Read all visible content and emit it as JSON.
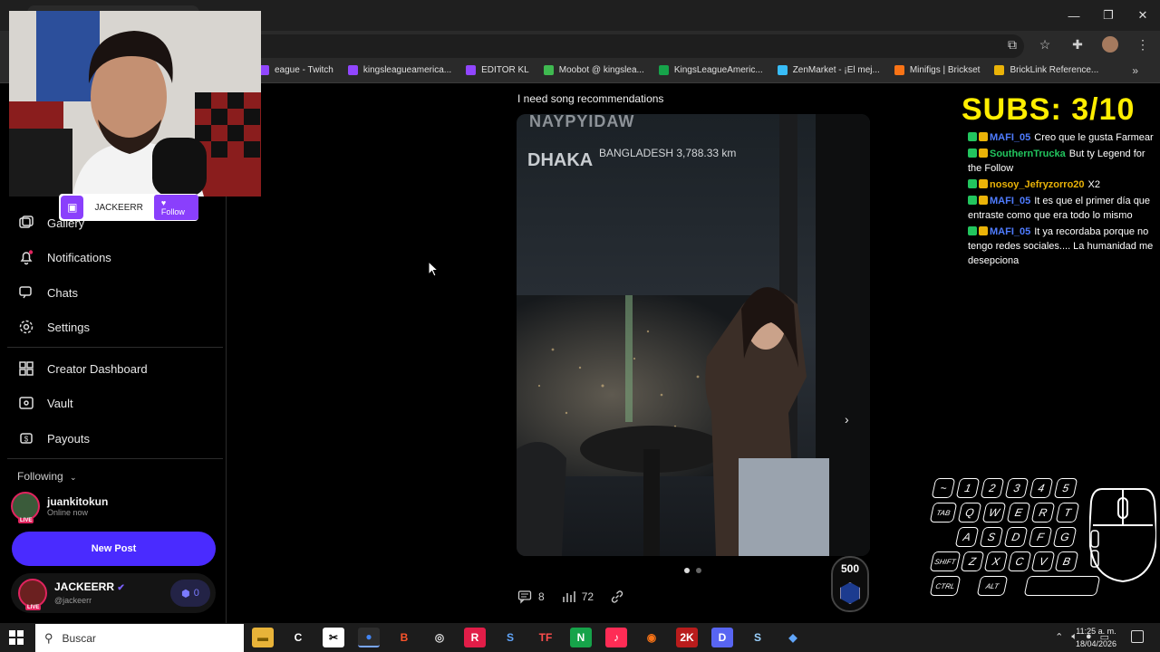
{
  "browser": {
    "bookmarks": [
      {
        "label": "eague - Twitch",
        "color": "#9146ff"
      },
      {
        "label": "kingsleagueamerica...",
        "color": "#9146ff"
      },
      {
        "label": "EDITOR KL",
        "color": "#9146ff"
      },
      {
        "label": "Moobot @ kingslea...",
        "color": "#3fb950"
      },
      {
        "label": "KingsLeagueAmeric...",
        "color": "#16a34a"
      },
      {
        "label": "ZenMarket - ¡El mej...",
        "color": "#38bdf8"
      },
      {
        "label": "Minifigs | Brickset",
        "color": "#f97316"
      },
      {
        "label": "BrickLink Reference...",
        "color": "#eab308"
      }
    ],
    "more_bookmarks_glyph": "»"
  },
  "sidebar": {
    "items": [
      {
        "label": "Gallery",
        "icon": "gallery-icon"
      },
      {
        "label": "Notifications",
        "icon": "bell-icon"
      },
      {
        "label": "Chats",
        "icon": "chat-icon"
      },
      {
        "label": "Settings",
        "icon": "gear-icon"
      },
      {
        "label": "Creator Dashboard",
        "icon": "dashboard-icon"
      },
      {
        "label": "Vault",
        "icon": "vault-icon"
      },
      {
        "label": "Payouts",
        "icon": "payouts-icon"
      }
    ],
    "following_label": "Following",
    "following_user": {
      "name": "juankitokun",
      "status": "Online now",
      "live": "LIVE"
    },
    "new_post_label": "New Post",
    "me": {
      "name": "JACKEERR",
      "handle": "@jackeerr",
      "live": "LIVE",
      "points": "0"
    }
  },
  "post": {
    "text": "I need song recommendations",
    "overlay_top": "NAYPYIDAW",
    "overlay_city": "DHAKA",
    "overlay_country": "BANGLADESH  3,788.33 km",
    "comments": "8",
    "views": "72",
    "carousel_next": "›"
  },
  "stream": {
    "follow_name": "JACKEERR",
    "follow_button": "Follow",
    "subs": "SUBS:  3/10",
    "points_value": "500",
    "chat": [
      {
        "user": "MAFI_05",
        "user_color": "#4f7cff",
        "badges": [
          "k",
          "y"
        ],
        "text": "Creo que le gusta Farmear"
      },
      {
        "user": "SouthernTrucka",
        "user_color": "#22c55e",
        "badges": [
          "k",
          "y"
        ],
        "text": "But ty Legend for the Follow"
      },
      {
        "user": "nosoy_Jefryzorro20",
        "user_color": "#eab308",
        "badges": [
          "k",
          "y"
        ],
        "text": "X2"
      },
      {
        "user": "MAFI_05",
        "user_color": "#4f7cff",
        "badges": [
          "k",
          "y"
        ],
        "text": "It es que el primer día que entraste como que era todo lo mismo"
      },
      {
        "user": "MAFI_05",
        "user_color": "#4f7cff",
        "badges": [
          "k",
          "y"
        ],
        "text": "It ya recordaba porque no tengo redes sociales.... La humanidad me desepciona"
      }
    ],
    "keyboard": {
      "row1": [
        "~",
        "1",
        "2",
        "3",
        "4",
        "5"
      ],
      "row2": [
        "TAB",
        "Q",
        "W",
        "E",
        "R",
        "T"
      ],
      "row3": [
        "A",
        "S",
        "D",
        "F",
        "G"
      ],
      "row4": [
        "SHIFT",
        "Z",
        "X",
        "C",
        "V",
        "B"
      ],
      "row5": [
        "CTRL",
        "ALT",
        ""
      ]
    }
  },
  "taskbar": {
    "search_placeholder": "Buscar",
    "time": "11:25 a. m.",
    "date": "18/04/2026",
    "apps": [
      {
        "name": "file-explorer",
        "glyph": "▬",
        "bg": "#e8b339",
        "fg": "#7a5a00"
      },
      {
        "name": "capcut",
        "glyph": "C",
        "bg": "transparent",
        "fg": "#ffffff"
      },
      {
        "name": "capcut-alt",
        "glyph": "✂",
        "bg": "#ffffff",
        "fg": "#000000"
      },
      {
        "name": "chrome",
        "glyph": "●",
        "bg": "#2d2d2d",
        "fg": "#4285f4"
      },
      {
        "name": "brave",
        "glyph": "B",
        "bg": "transparent",
        "fg": "#fb542b"
      },
      {
        "name": "obs",
        "glyph": "◎",
        "bg": "transparent",
        "fg": "#dddddd"
      },
      {
        "name": "roblox",
        "glyph": "R",
        "bg": "#e11d48",
        "fg": "#ffffff"
      },
      {
        "name": "sling",
        "glyph": "S",
        "bg": "transparent",
        "fg": "#60a5fa"
      },
      {
        "name": "tf",
        "glyph": "TF",
        "bg": "transparent",
        "fg": "#ff4d4d"
      },
      {
        "name": "spreadsheet",
        "glyph": "N",
        "bg": "#16a34a",
        "fg": "#ffffff"
      },
      {
        "name": "tiktok",
        "glyph": "♪",
        "bg": "#fe2c55",
        "fg": "#ffffff"
      },
      {
        "name": "blender",
        "glyph": "◉",
        "bg": "transparent",
        "fg": "#f97316"
      },
      {
        "name": "nba",
        "glyph": "2K",
        "bg": "#b91c1c",
        "fg": "#ffffff"
      },
      {
        "name": "discord",
        "glyph": "D",
        "bg": "#5865f2",
        "fg": "#ffffff"
      },
      {
        "name": "steam",
        "glyph": "S",
        "bg": "transparent",
        "fg": "#9bd1ff"
      },
      {
        "name": "rocket-league",
        "glyph": "◆",
        "bg": "transparent",
        "fg": "#60a5fa"
      }
    ]
  },
  "colors": {
    "accent": "#4a2bff",
    "twitch_purple": "#8a3ffc",
    "subs_yellow": "#ffee00"
  }
}
